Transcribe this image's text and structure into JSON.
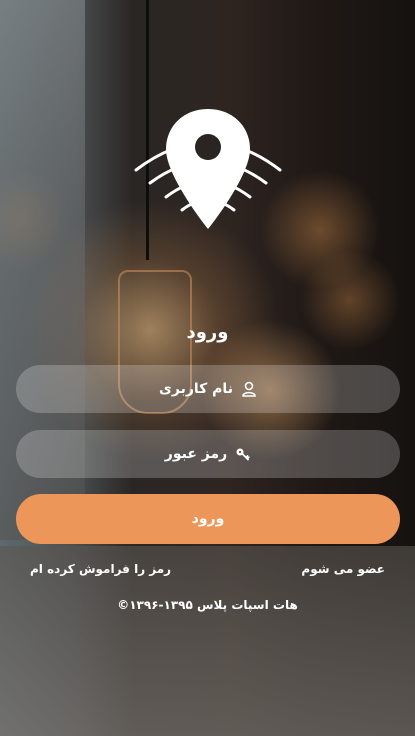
{
  "login": {
    "title": "ورود",
    "username_placeholder": "نام کاربری",
    "password_placeholder": "رمز عبور",
    "submit_label": "ورود",
    "join_link": "عضو می شوم",
    "forgot_link": "رمز را فراموش کرده ام",
    "copyright": "©۱۳۹۶-۱۳۹۵ هات اسپات پلاس"
  },
  "icons": {
    "logo": "location-pin-wifi-icon",
    "username": "user-icon",
    "password": "key-icon"
  },
  "colors": {
    "primary_button": "#ec965a",
    "text": "#ffffff"
  }
}
